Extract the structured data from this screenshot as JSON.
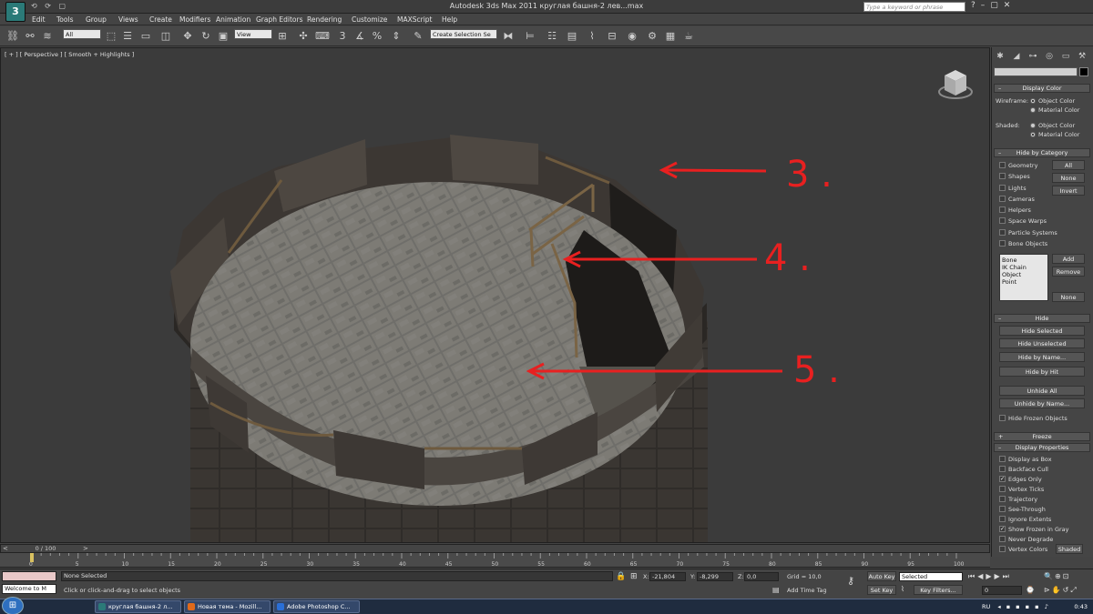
{
  "title_bar": {
    "app_logo": "3",
    "title": "Autodesk 3ds Max  2011      круглая башня-2 лев...max",
    "search_placeholder": "Type a keyword or phrase",
    "quick_access": "⟲ ⟳ ▢"
  },
  "menu": [
    "Edit",
    "Tools",
    "Group",
    "Views",
    "Create",
    "Modifiers",
    "Animation",
    "Graph Editors",
    "Rendering",
    "Customize",
    "MAXScript",
    "Help"
  ],
  "toolbar": {
    "selection_filter": "All",
    "reference_coord": "View",
    "named_selection": "Create Selection Se",
    "angle_snap_label": "3"
  },
  "viewport": {
    "label": "[ + ] [ Perspective ] [ Smooth + Highlights ]",
    "annotations": [
      {
        "text": "3 ."
      },
      {
        "text": "4 ."
      },
      {
        "text": "5 ."
      }
    ]
  },
  "command_panel": {
    "display_color": {
      "title": "Display Color",
      "wireframe_label": "Wireframe:",
      "shaded_label": "Shaded:",
      "object_color": "Object Color",
      "material_color": "Material Color",
      "wireframe_selected": "Object Color",
      "shaded_selected": "Material Color"
    },
    "hide_by_category": {
      "title": "Hide by Category",
      "items": [
        {
          "label": "Geometry",
          "checked": false
        },
        {
          "label": "Shapes",
          "checked": false
        },
        {
          "label": "Lights",
          "checked": false
        },
        {
          "label": "Cameras",
          "checked": false
        },
        {
          "label": "Helpers",
          "checked": false
        },
        {
          "label": "Space Warps",
          "checked": false
        },
        {
          "label": "Particle Systems",
          "checked": false
        },
        {
          "label": "Bone Objects",
          "checked": false
        }
      ],
      "buttons": [
        "All",
        "None",
        "Invert"
      ],
      "list": [
        "Bone",
        "IK Chain Object",
        "Point"
      ],
      "list_buttons": [
        "Add",
        "Remove",
        "None"
      ]
    },
    "hide": {
      "title": "Hide",
      "buttons": [
        "Hide Selected",
        "Hide Unselected",
        "Hide by Name...",
        "Hide by Hit",
        "Unhide All",
        "Unhide by Name..."
      ],
      "hide_frozen": "Hide Frozen Objects"
    },
    "freeze": {
      "title": "Freeze"
    },
    "display_properties": {
      "title": "Display Properties",
      "items": [
        {
          "label": "Display as Box",
          "checked": false
        },
        {
          "label": "Backface Cull",
          "checked": false
        },
        {
          "label": "Edges Only",
          "checked": true
        },
        {
          "label": "Vertex Ticks",
          "checked": false
        },
        {
          "label": "Trajectory",
          "checked": false
        },
        {
          "label": "See-Through",
          "checked": false
        },
        {
          "label": "Ignore Extents",
          "checked": false
        },
        {
          "label": "Show Frozen in Gray",
          "checked": true
        },
        {
          "label": "Never Degrade",
          "checked": false
        },
        {
          "label": "Vertex Colors",
          "checked": false
        }
      ],
      "shaded_button": "Shaded"
    }
  },
  "time_slider": {
    "label": "0 / 100",
    "ticks": [
      "0",
      "5",
      "10",
      "15",
      "20",
      "25",
      "30",
      "35",
      "40",
      "45",
      "50",
      "55",
      "60",
      "65",
      "70",
      "75",
      "80",
      "85",
      "90",
      "95",
      "100"
    ]
  },
  "status": {
    "selection": "None Selected",
    "prompt": "Click or click-and-drag to select objects",
    "maxscript": "Welcome to M",
    "x_label": "X:",
    "x_value": "-21,804",
    "y_label": "Y:",
    "y_value": "-8,299",
    "z_label": "Z:",
    "z_value": "0,0",
    "grid": "Grid = 10,0",
    "add_time_tag": "Add Time Tag",
    "auto_key": "Auto Key",
    "set_key": "Set Key",
    "key_mode": "Selected",
    "key_filters": "Key Filters...",
    "frame": "0"
  },
  "taskbar": {
    "tasks": [
      {
        "label": "круглая башня-2 л...",
        "color": "#2b7a78"
      },
      {
        "label": "Новая тема - Mozill...",
        "color": "#e06a1a"
      },
      {
        "label": "Adobe Photoshop C...",
        "color": "#2a6fd6"
      }
    ],
    "lang": "RU",
    "clock": "0:43"
  }
}
